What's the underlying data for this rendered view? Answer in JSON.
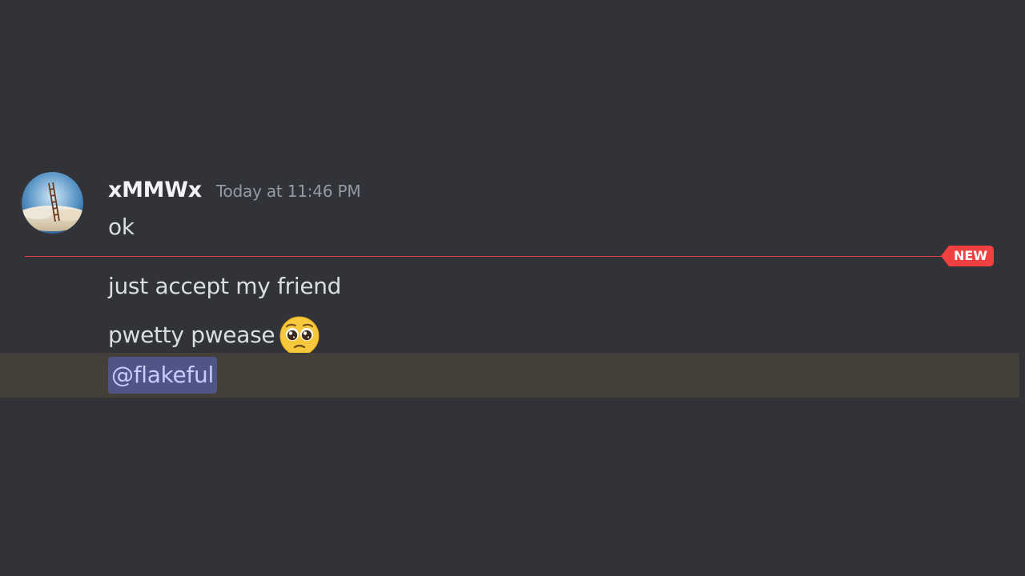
{
  "message": {
    "author": "xMMWx",
    "timestamp": "Today at 11:46 PM",
    "lines": [
      "ok",
      "just accept my friend",
      "pwetty pwease"
    ],
    "mention": "@flakeful",
    "emoji": "pleading-face"
  },
  "divider": {
    "label": "NEW"
  },
  "colors": {
    "background": "#313338",
    "new_badge": "#f23f42",
    "mention_highlight": "#444039",
    "mention_pill": "#505587"
  }
}
